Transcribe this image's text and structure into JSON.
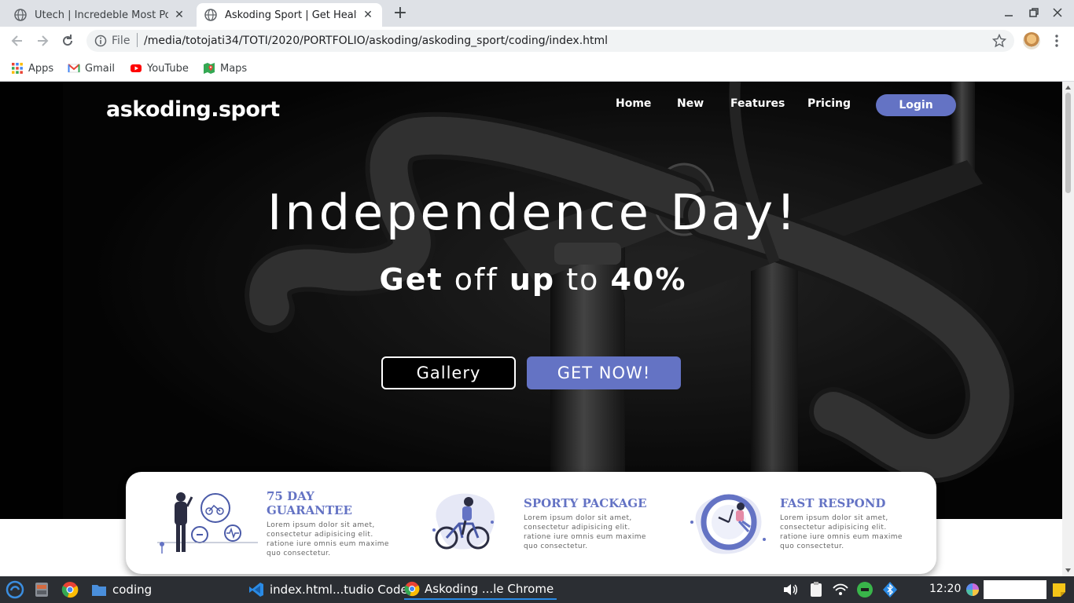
{
  "browser": {
    "tabs": [
      {
        "title": "Utech | Incredeble Most Po",
        "active": false
      },
      {
        "title": "Askoding Sport | Get Healt",
        "active": true
      }
    ],
    "address": {
      "scheme": "File",
      "url": "/media/totojati34/TOTI/2020/PORTFOLIO/askoding/askoding_sport/coding/index.html"
    },
    "bookmarks": [
      "Apps",
      "Gmail",
      "YouTube",
      "Maps"
    ]
  },
  "site": {
    "brand": "askoding.sport",
    "nav": [
      "Home",
      "New",
      "Features",
      "Pricing"
    ],
    "login": "Login",
    "hero": {
      "headline": "Independence Day!",
      "sub": {
        "w1": "Get",
        "w2": "off",
        "w3": "up",
        "w4": "to",
        "w5": "40%"
      },
      "btn_gallery": "Gallery",
      "btn_getnow": "GET NOW!"
    },
    "features": [
      {
        "title_line1": "75 DAY",
        "title_line2": "GUARANTEE",
        "text": "Lorem ipsum dolor sit amet, consectetur adipisicing elit. ratione iure omnis eum maxime quo consectetur."
      },
      {
        "title_line1": "SPORTY PACKAGE",
        "title_line2": "",
        "text": "Lorem ipsum dolor sit amet, consectetur adipisicing elit. ratione iure omnis eum maxime quo consectetur."
      },
      {
        "title_line1": "FAST RESPOND",
        "title_line2": "",
        "text": "Lorem ipsum dolor sit amet, consectetur adipisicing elit. ratione iure omnis eum maxime quo consectetur."
      }
    ],
    "accent_color": "#6473c4"
  },
  "taskbar": {
    "items": [
      "coding",
      "index.html...tudio Code",
      "Askoding ...le Chrome"
    ],
    "clock": "12:20"
  }
}
